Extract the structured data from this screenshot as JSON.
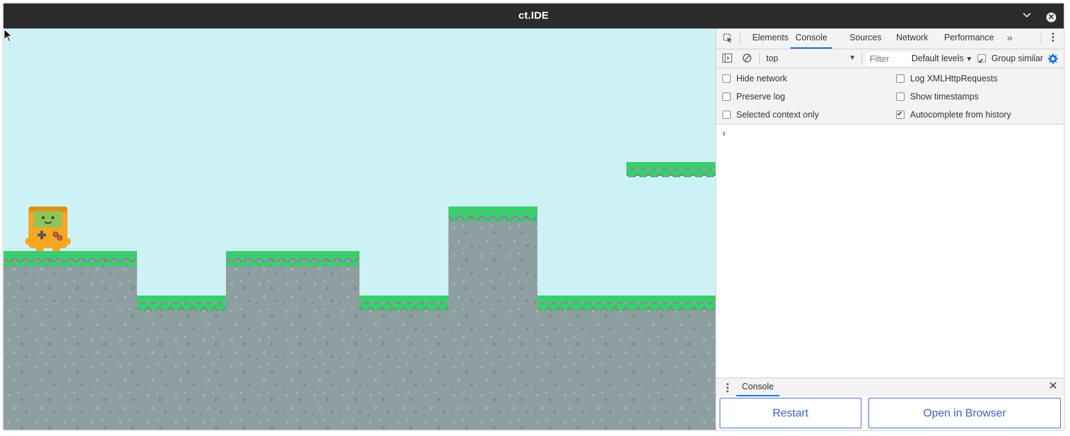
{
  "window": {
    "title": "ct.IDE"
  },
  "titlebar": {
    "minimize_glyph": "⌄",
    "close_glyph": "✕"
  },
  "devtools": {
    "tabs": [
      {
        "label": "Elements"
      },
      {
        "label": "Console",
        "active": true
      },
      {
        "label": "Sources"
      },
      {
        "label": "Network"
      },
      {
        "label": "Performance"
      }
    ],
    "more_tabs_glyph": "»",
    "toolbar": {
      "context": "top",
      "filter_placeholder": "Filter",
      "levels": "Default levels",
      "group_similar": "Group similar",
      "group_similar_checked": true
    },
    "settings": {
      "left": [
        {
          "label": "Hide network",
          "checked": false
        },
        {
          "label": "Preserve log",
          "checked": false
        },
        {
          "label": "Selected context only",
          "checked": false
        }
      ],
      "right": [
        {
          "label": "Log XMLHttpRequests",
          "checked": false
        },
        {
          "label": "Show timestamps",
          "checked": false
        },
        {
          "label": "Autocomplete from history",
          "checked": true
        }
      ]
    },
    "prompt_glyph": "›",
    "drawer": {
      "tab": "Console",
      "close_glyph": "✕"
    }
  },
  "actions": {
    "restart": "Restart",
    "open_in_browser": "Open in Browser"
  },
  "colors": {
    "sky": "#cdf2f5",
    "grass": "#3ccd6e",
    "rock": "#8a9ea0",
    "accent_blue": "#1a73e8",
    "button_text": "#3f62c2"
  },
  "icons": [
    "inspect-element-icon",
    "sidebar-toggle-icon",
    "clear-console-icon",
    "gear-icon",
    "more-tabs-icon",
    "kebab-menu-icon",
    "close-icon",
    "mouse-cursor-icon",
    "game-character"
  ]
}
